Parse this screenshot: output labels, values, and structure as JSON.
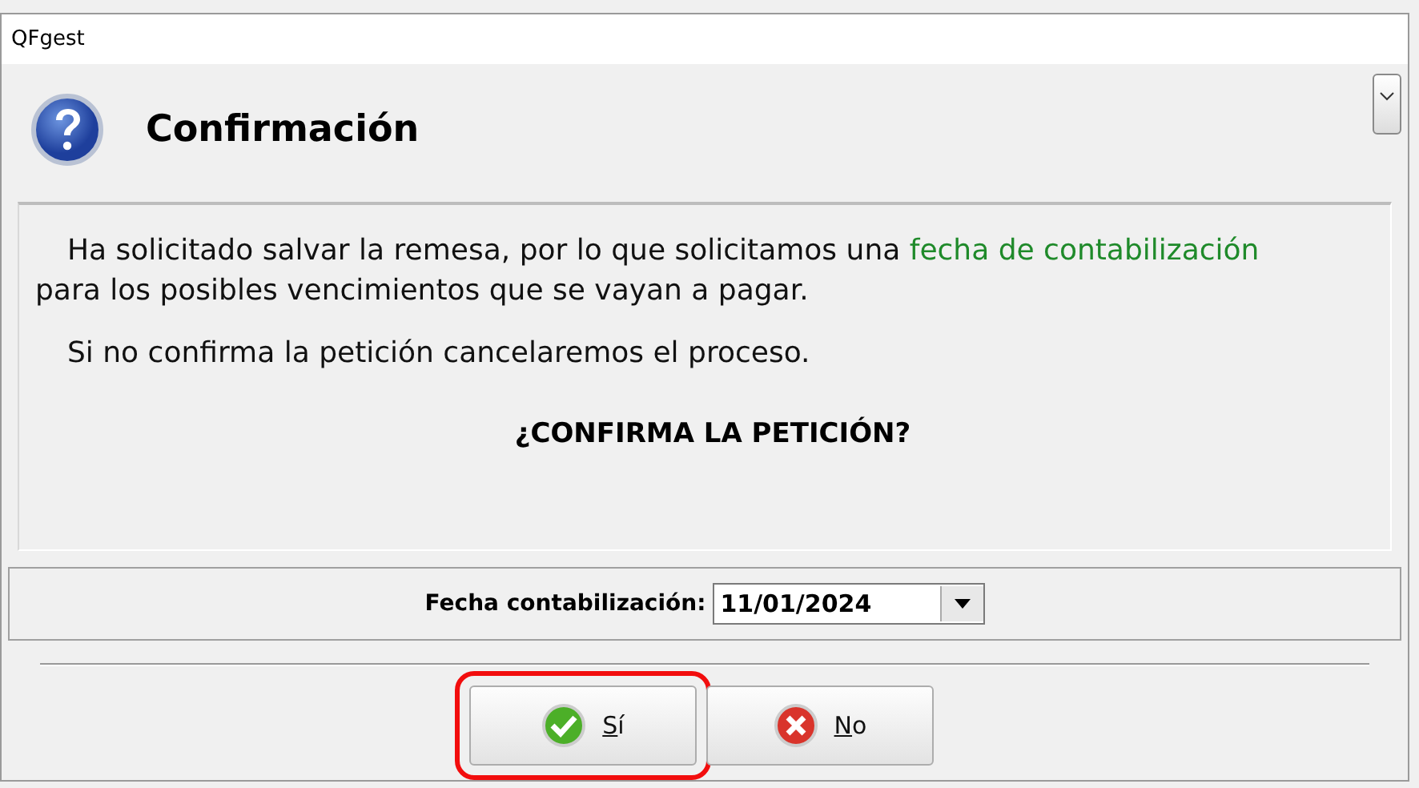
{
  "window": {
    "title": "QFgest"
  },
  "header": {
    "title": "Confirmación",
    "expanded": false
  },
  "message": {
    "paragraphs": [
      {
        "segments": [
          {
            "text": "Ha solicitado salvar la remesa, por lo que solicitamos una ",
            "emphasis": false
          },
          {
            "text": "fecha de contabilización",
            "emphasis": true
          },
          {
            "text": " para los posibles vencimientos que se vayan a pagar.",
            "emphasis": false
          }
        ]
      },
      {
        "segments": [
          {
            "text": "Si no confirma la petición cancelaremos el proceso.",
            "emphasis": false
          }
        ]
      }
    ],
    "question": "¿CONFIRMA LA PETICIÓN?"
  },
  "date_field": {
    "label": "Fecha contabilización:",
    "value": "11/01/2024"
  },
  "buttons": [
    {
      "label": "Sí",
      "kind": "yes",
      "highlighted": true
    },
    {
      "label": "No",
      "kind": "no",
      "highlighted": false
    }
  ]
}
